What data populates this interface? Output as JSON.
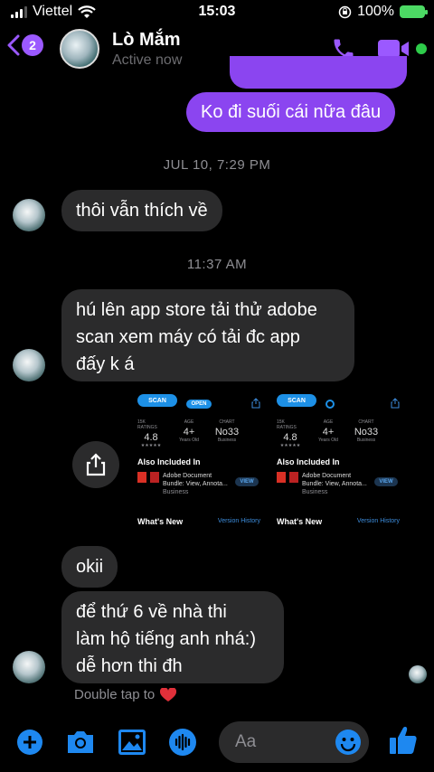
{
  "status_bar": {
    "carrier": "Viettel",
    "time": "15:03",
    "battery": "100%"
  },
  "header": {
    "badge_count": "2",
    "name": "Lò Mắm",
    "status": "Active now"
  },
  "messages": {
    "out_top_1": "Ko đi suối cái nữa đâu",
    "timestamp_1": "JUL 10, 7:29 PM",
    "in_1": "thôi vẫn thích về",
    "timestamp_2": "11:37 AM",
    "in_2_line1": "hú lên app store tải thử adobe",
    "in_2_line2": "scan xem máy có tải đc app",
    "in_2_line3": "đấy k á",
    "in_3": "okii",
    "in_4_line1": "để thứ 6 về nhà thi",
    "in_4_line2": "làm hộ tiếng anh nhá:)",
    "in_4_line3": "dễ hơn thi đh"
  },
  "screenshot_image": {
    "scan_label": "SCAN",
    "open_label": "OPEN",
    "ratings_label": "15K RATINGS",
    "rating_value": "4.8",
    "age_label": "AGE",
    "age_value": "4+",
    "age_sub": "Years Old",
    "chart_label": "CHART",
    "chart_value": "No33",
    "chart_sub": "Business",
    "also_included": "Also Included In",
    "doc_name_1": "Adobe Document",
    "doc_name_2": "Bundle: View, Annota...",
    "doc_cat": "Business",
    "view_label": "VIEW",
    "whats_new": "What's New",
    "version_history": "Version History"
  },
  "footer": {
    "double_tap": "Double tap to",
    "input_placeholder": "Aa"
  },
  "colors": {
    "accent": "#8b45f0",
    "incoming_bubble": "#2b2b2c",
    "online_dot": "#2ecc4a"
  }
}
